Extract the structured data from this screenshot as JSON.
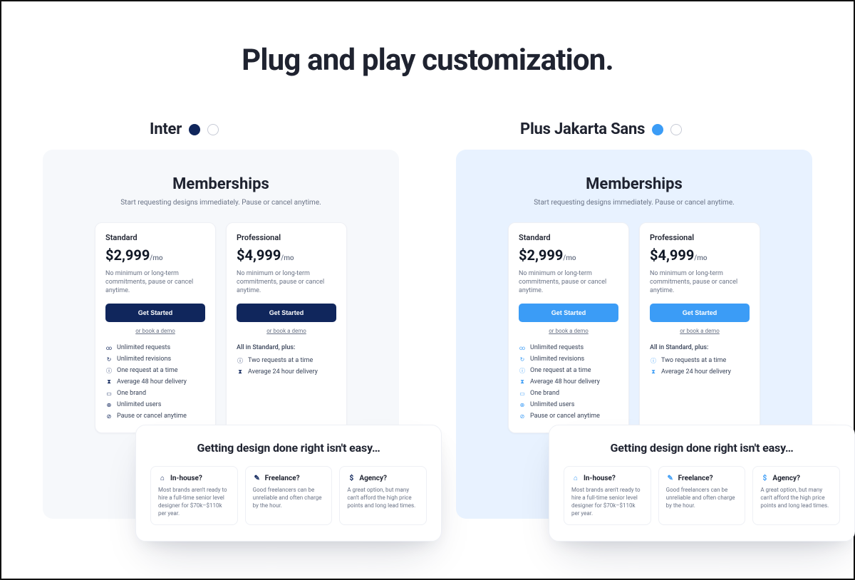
{
  "page_title": "Plug and play customization.",
  "themes": [
    {
      "name": "Inter",
      "accent": "#10265c",
      "swatches": [
        "navy",
        "outline"
      ],
      "membership": {
        "title": "Memberships",
        "subtitle": "Start requesting designs immediately. Pause or cancel anytime.",
        "plans": [
          {
            "name": "Standard",
            "price": "$2,999",
            "per": "/mo",
            "note": "No minimum or long-term commitments, pause or cancel anytime.",
            "cta": "Get Started",
            "demo": "or book a demo",
            "features_title": "",
            "features": [
              "Unlimited requests",
              "Unlimited revisions",
              "One request at a time",
              "Average 48 hour delivery",
              "One brand",
              "Unlimited users",
              "Pause or cancel anytime"
            ]
          },
          {
            "name": "Professional",
            "price": "$4,999",
            "per": "/mo",
            "note": "No minimum or long-term commitments, pause or cancel anytime.",
            "cta": "Get Started",
            "demo": "or book a demo",
            "features_title": "All in Standard, plus:",
            "features": [
              "Two requests at a time",
              "Average 24 hour delivery"
            ]
          }
        ]
      },
      "overlay": {
        "title": "Getting design done right isn't easy…",
        "cards": [
          {
            "icon": "home-icon",
            "heading": "In-house?",
            "body": "Most brands aren't ready to hire a full-time senior level designer for $70k–$110k per year."
          },
          {
            "icon": "palette-icon",
            "heading": "Freelance?",
            "body": "Good freelancers can be unreliable and often charge by the hour."
          },
          {
            "icon": "dollar-icon",
            "heading": "Agency?",
            "body": "A great option, but many can't afford the high price points and long lead times."
          }
        ]
      }
    },
    {
      "name": "Plus Jakarta Sans",
      "accent": "#3b9cf6",
      "swatches": [
        "sky",
        "outline"
      ],
      "membership": {
        "title": "Memberships",
        "subtitle": "Start requesting designs immediately. Pause or cancel anytime.",
        "plans": [
          {
            "name": "Standard",
            "price": "$2,999",
            "per": "/mo",
            "note": "No minimum or long-term commitments, pause or cancel anytime.",
            "cta": "Get Started",
            "demo": "or book a demo",
            "features_title": "",
            "features": [
              "Unlimited requests",
              "Unlimited revisions",
              "One request at a time",
              "Average 48 hour delivery",
              "One brand",
              "Unlimited users",
              "Pause or cancel anytime"
            ]
          },
          {
            "name": "Professional",
            "price": "$4,999",
            "per": "/mo",
            "note": "No minimum or long-term commitments, pause or cancel anytime.",
            "cta": "Get Started",
            "demo": "or book a demo",
            "features_title": "All in Standard, plus:",
            "features": [
              "Two requests at a time",
              "Average 24 hour delivery"
            ]
          }
        ]
      },
      "overlay": {
        "title": "Getting design done right isn't easy…",
        "cards": [
          {
            "icon": "home-icon",
            "heading": "In-house?",
            "body": "Most brands aren't ready to hire a full-time senior level designer for $70k–$110k per year."
          },
          {
            "icon": "palette-icon",
            "heading": "Freelance?",
            "body": "Good freelancers can be unreliable and often charge by the hour."
          },
          {
            "icon": "dollar-icon",
            "heading": "Agency?",
            "body": "A great option, but many can't afford the high price points and long lead times."
          }
        ]
      }
    }
  ]
}
